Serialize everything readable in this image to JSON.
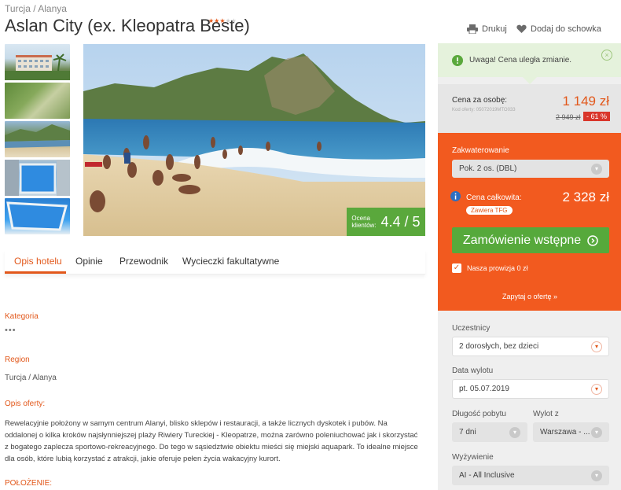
{
  "header": {
    "breadcrumb": "Turcja / Alanya",
    "title": "Aslan City (ex. Kleopatra Beste)",
    "stars_filled": 3,
    "stars_total": 5,
    "print_label": "Drukuj",
    "save_label": "Dodaj do schowka"
  },
  "gallery": {
    "rating_label_line1": "Ocena",
    "rating_label_line2": "klientów:",
    "rating_value": "4.4 / 5"
  },
  "tabs": [
    {
      "label": "Opis hotelu",
      "active": true
    },
    {
      "label": "Opinie",
      "active": false
    },
    {
      "label": "Przewodnik",
      "active": false
    },
    {
      "label": "Wycieczki fakultatywne",
      "active": false
    }
  ],
  "details": {
    "category_label": "Kategoria",
    "category_value": "•••",
    "region_label": "Region",
    "region_value": "Turcja / Alanya",
    "offer_label": "Opis oferty:",
    "offer_text": "Rewelacyjnie położony w samym centrum Alanyi, blisko sklepów i restauracji, a także licznych dyskotek i pubów. Na oddalonej o kilka kroków najsłynniejszej plaży Riwiery Tureckiej - Kleopatrze, można zarówno poleniuchować jak i skorzystać z bogatego zaplecza sportowo-rekreacyjnego. Do tego w sąsiedztwie obiektu mieści się miejski aquapark. To idealne miejsce dla osób, które lubią korzystać z atrakcji, jakie oferuje pełen życia wakacyjny kurort.",
    "location_label": "POŁOŻENIE:"
  },
  "sidebar": {
    "alert_text": "Uwaga! Cena uległa zmianie.",
    "price_label": "Cena za osobę:",
    "offer_code": "Kod oferty: 05072019MTO033",
    "price": "1 149 zł",
    "old_price": "2 949 zł",
    "discount": "- 61 %",
    "accommodation_label": "Zakwaterowanie",
    "accommodation_value": "Pok. 2 os. (DBL)",
    "total_label": "Cena całkowita:",
    "total_badge": "Zawiera TFG",
    "total_price": "2 328 zł",
    "order_button": "Zamówienie wstępne",
    "commission_label": "Nasza prowizja 0 zł",
    "ask_link": "Zapytaj o ofertę »",
    "participants_label": "Uczestnicy",
    "participants_value": "2 dorosłych, bez dzieci",
    "departure_date_label": "Data wylotu",
    "departure_date_value": "pt. 05.07.2019",
    "duration_label": "Długość pobytu",
    "duration_value": "7 dni",
    "departure_from_label": "Wylot z",
    "departure_from_value": "Warszawa - ...",
    "board_label": "Wyżywienie",
    "board_value": "AI - All Inclusive"
  },
  "colors": {
    "accent": "#e2581b",
    "orange_panel": "#f25a1f",
    "green": "#56a93b",
    "discount_red": "#d9362b"
  }
}
